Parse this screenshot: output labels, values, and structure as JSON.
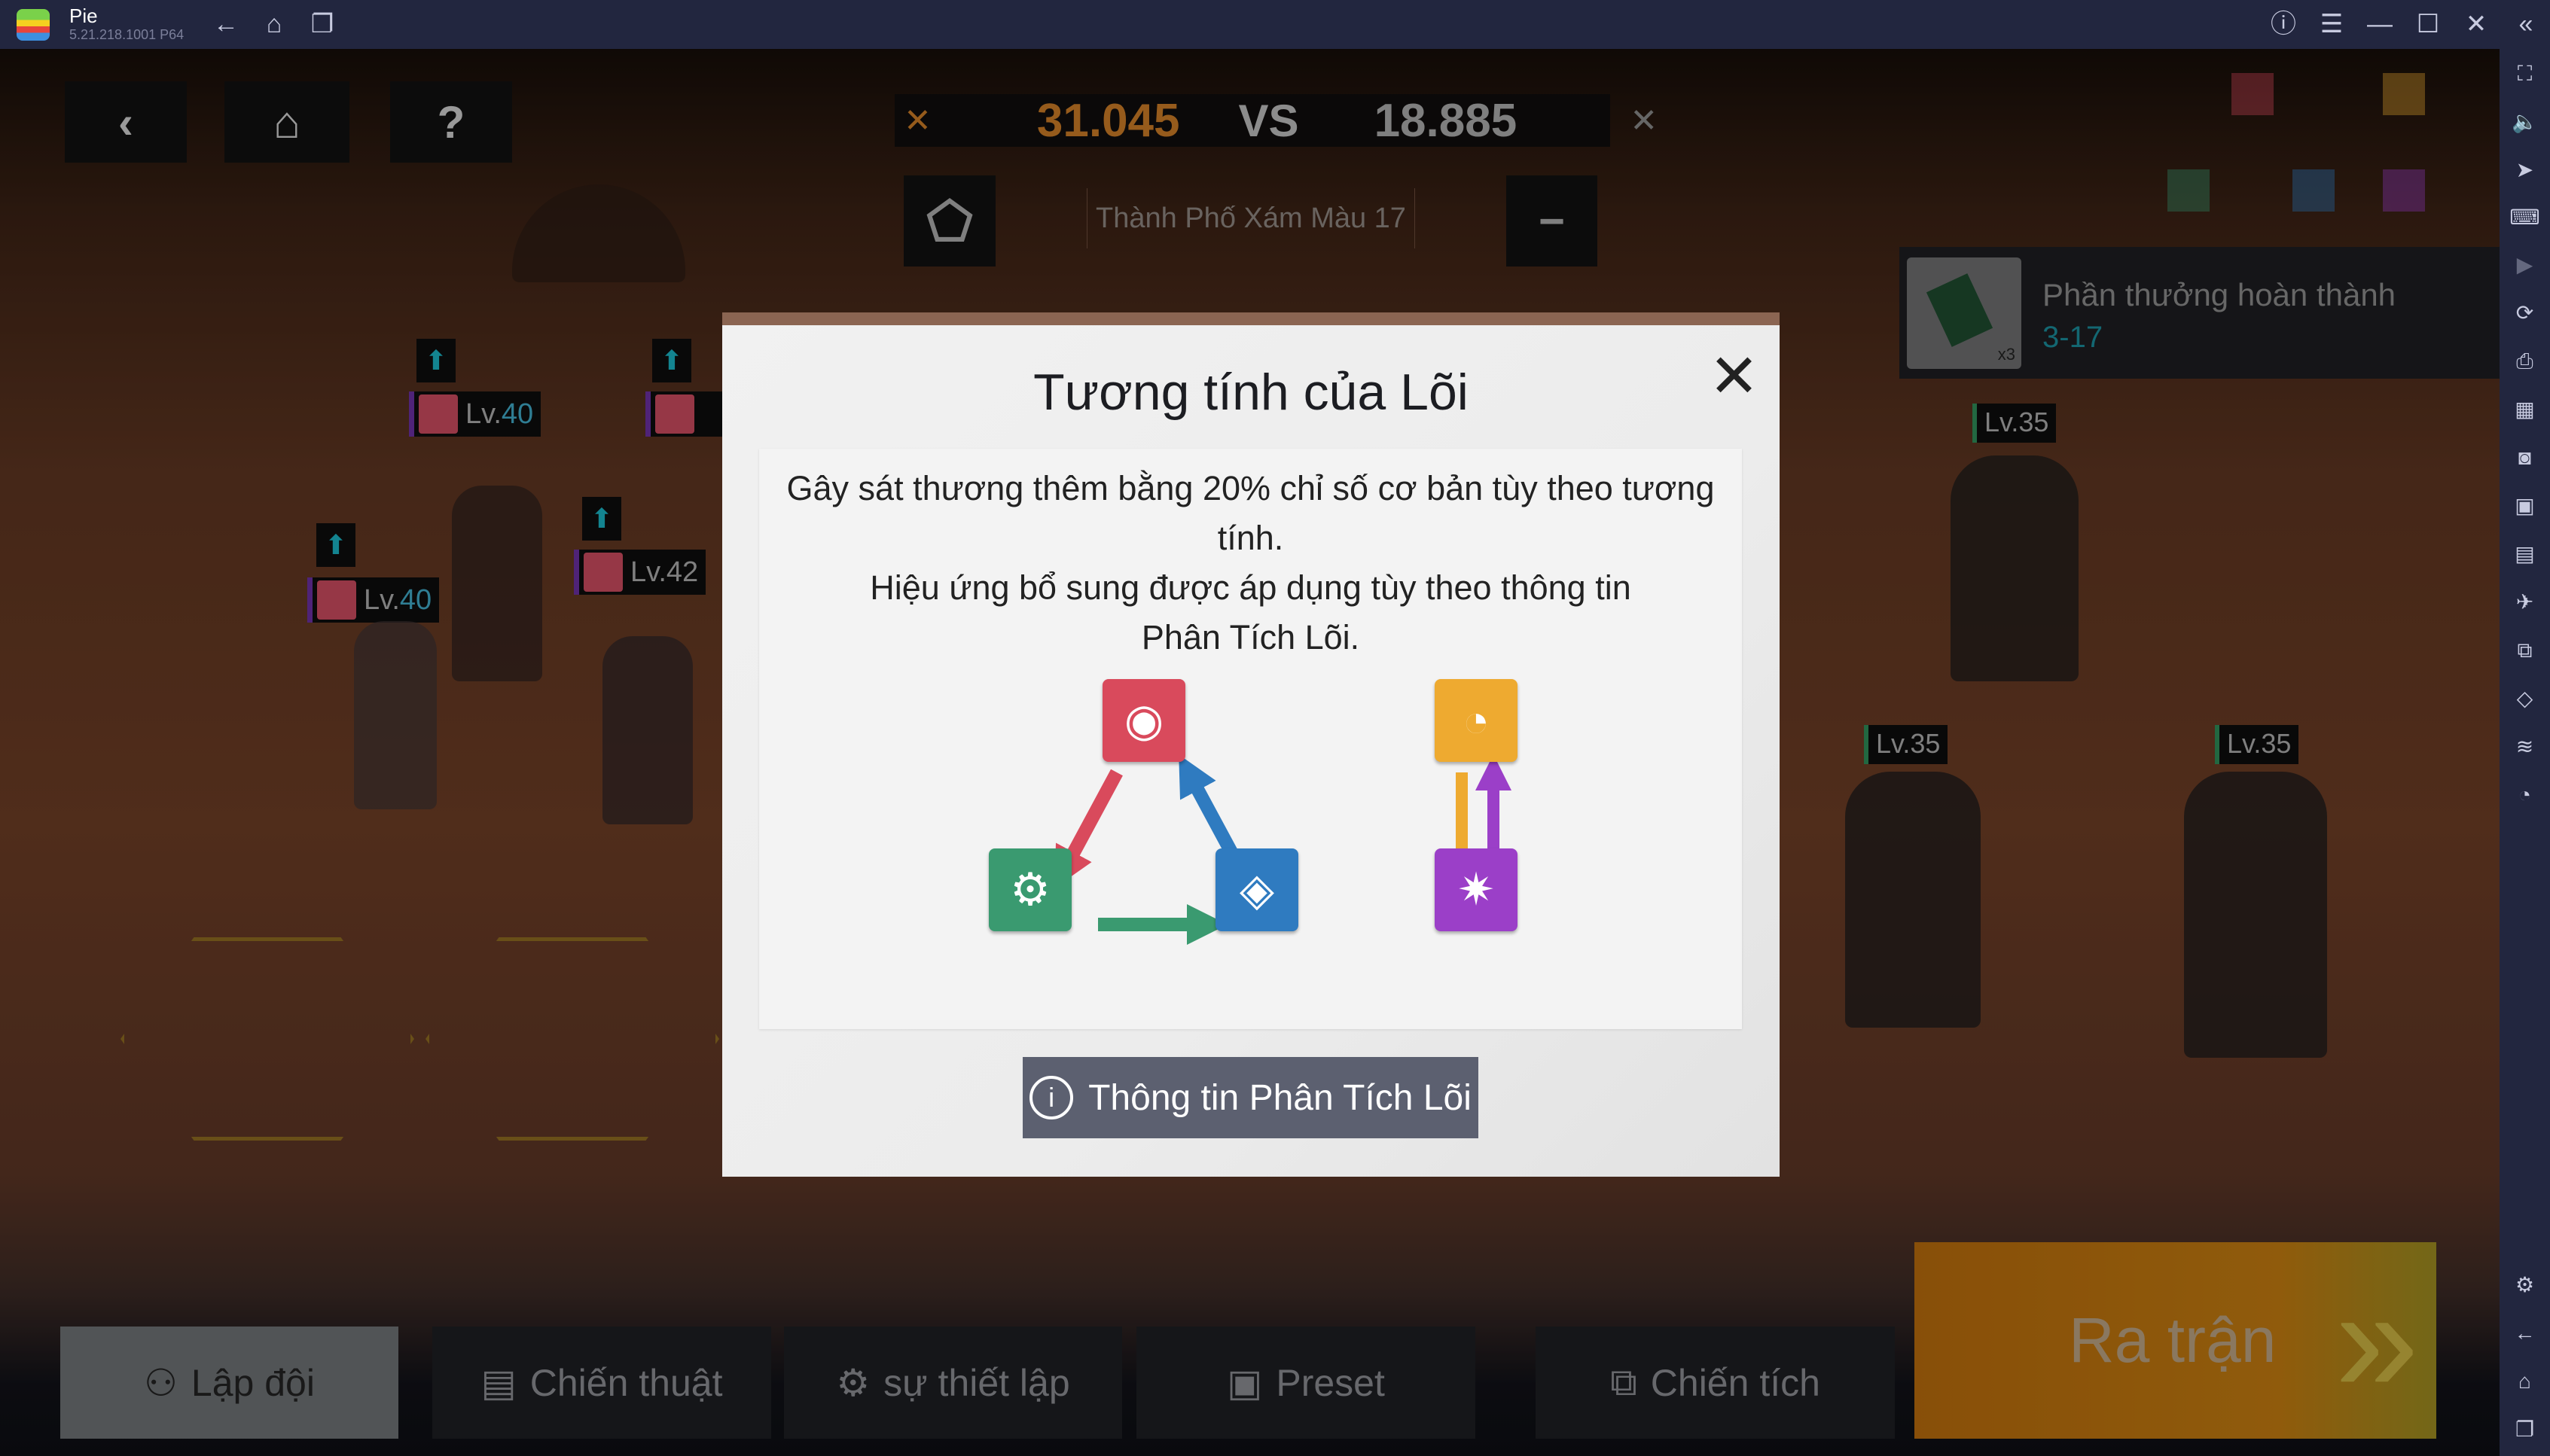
{
  "window": {
    "app_name": "Pie",
    "version": "5.21.218.1001  P64"
  },
  "hud": {
    "score_left": "31.045",
    "vs": "VS",
    "score_right": "18.885",
    "stage_name": "Thành Phố Xám Màu 17",
    "reward_title": "Phần thưởng hoàn thành",
    "reward_stage": "3-17",
    "reward_count": "x3"
  },
  "units": {
    "allies": [
      {
        "lv": "Lv.",
        "num": "40"
      },
      {
        "lv": "Lv.",
        "num": "40"
      },
      {
        "lv": "Lv.",
        "num": "42"
      },
      {
        "lv": "Lv.",
        "num": "40"
      }
    ],
    "enemies": [
      "Lv.35",
      "Lv.35",
      "Lv.35"
    ]
  },
  "modal": {
    "title": "Tương tính của Lõi",
    "line1": "Gây sát thương thêm bằng 20% chỉ số cơ bản tùy theo tương tính.",
    "line2": "Hiệu ứng bổ sung được áp dụng tùy theo thông tin Phân Tích Lõi.",
    "info_button": "Thông tin Phân Tích Lõi"
  },
  "tabs": {
    "team": "Lập đội",
    "tactics": "Chiến thuật",
    "setup": "sự thiết lập",
    "preset": "Preset",
    "record": "Chiến tích",
    "start": "Ra trận"
  },
  "colors": {
    "red_core": "#d94a5c",
    "green_core": "#3a9a70",
    "blue_core": "#2f7bc0",
    "yellow_core": "#eeaa30",
    "purple_core": "#9b3fc8",
    "accent_orange": "#c87a26",
    "cyan": "#1ab0c0"
  }
}
